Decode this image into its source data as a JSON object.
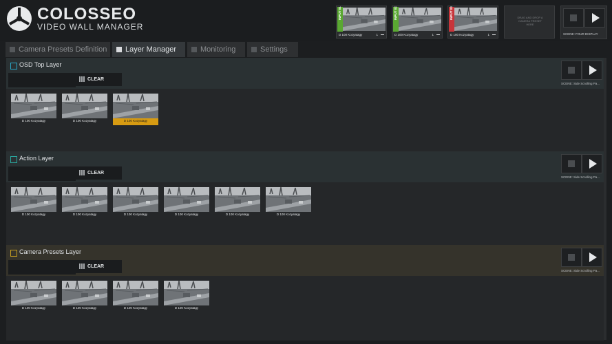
{
  "brand": {
    "name": "COLOSSEO",
    "subtitle": "VIDEO WALL MANAGER",
    "logo_icon": "colosseo-logo-icon"
  },
  "inputs": [
    {
      "label": "INPUT 01",
      "stripe_color": "#5aa832",
      "caption": "D 100 Kozyatagy",
      "number": "1"
    },
    {
      "label": "INPUT 02",
      "stripe_color": "#5aa832",
      "caption": "D 100 Kozyatagy",
      "number": "1"
    },
    {
      "label": "INPUT 03",
      "stripe_color": "#c8353a",
      "caption": "D 100 Kozyatagy",
      "number": "1"
    },
    {
      "label": "INPUT 04",
      "stripe_color": "#3a3c3e",
      "placeholder": "DRAG AND DROP A CAMERA PRESET HERE"
    }
  ],
  "header_scene": {
    "label": "SCENE: FOUR DISPLAY"
  },
  "tabs": [
    {
      "label": "Camera Presets Definition",
      "icon": "list-icon",
      "active": false
    },
    {
      "label": "Layer Manager",
      "icon": "layers-icon",
      "active": true
    },
    {
      "label": "Monitoring",
      "icon": "monitor-icon",
      "active": false
    },
    {
      "label": "Settings",
      "icon": "gear-icon",
      "active": false
    }
  ],
  "layers": [
    {
      "title": "OSD Top Layer",
      "head_bg": "#2a3133",
      "check_color": "#2aa8c8",
      "clear_label": "CLEAR FILTER",
      "scene_label": "SCENE: Side Scrolling Pa...",
      "filter_value": "",
      "cards": [
        {
          "caption": "D 100 Kozyatagy",
          "selected": false
        },
        {
          "caption": "D 100 Kozyatagy",
          "selected": false
        },
        {
          "caption": "D 100 Kozyatagy",
          "selected": true
        }
      ]
    },
    {
      "title": "Action Layer",
      "head_bg": "#2a3133",
      "check_color": "#2aa8a0",
      "clear_label": "CLEAR FILTER",
      "scene_label": "SCENE: Side Scrolling Pa...",
      "filter_value": "",
      "cards": [
        {
          "caption": "D 100 Kozyatagy",
          "selected": false
        },
        {
          "caption": "D 100 Kozyatagy",
          "selected": false
        },
        {
          "caption": "D 100 Kozyatagy",
          "selected": false
        },
        {
          "caption": "D 100 Kozyatagy",
          "selected": false
        },
        {
          "caption": "D 100 Kozyatagy",
          "selected": false
        },
        {
          "caption": "D 100 Kozyatagy",
          "selected": false
        }
      ]
    },
    {
      "title": "Camera Presets Layer",
      "head_bg": "#35332b",
      "check_color": "#c8a020",
      "clear_label": "CLEAR FILTER",
      "scene_label": "SCENE: Side Scrolling Pa...",
      "filter_value": "",
      "cards": [
        {
          "caption": "D 100 Kozyatagy",
          "selected": false
        },
        {
          "caption": "D 100 Kozyatagy",
          "selected": false
        },
        {
          "caption": "D 100 Kozyatagy",
          "selected": false
        },
        {
          "caption": "D 100 Kozyatagy",
          "selected": false
        }
      ]
    }
  ],
  "colors": {
    "accent_selected": "#d79b12",
    "background": "#1c1e20"
  }
}
